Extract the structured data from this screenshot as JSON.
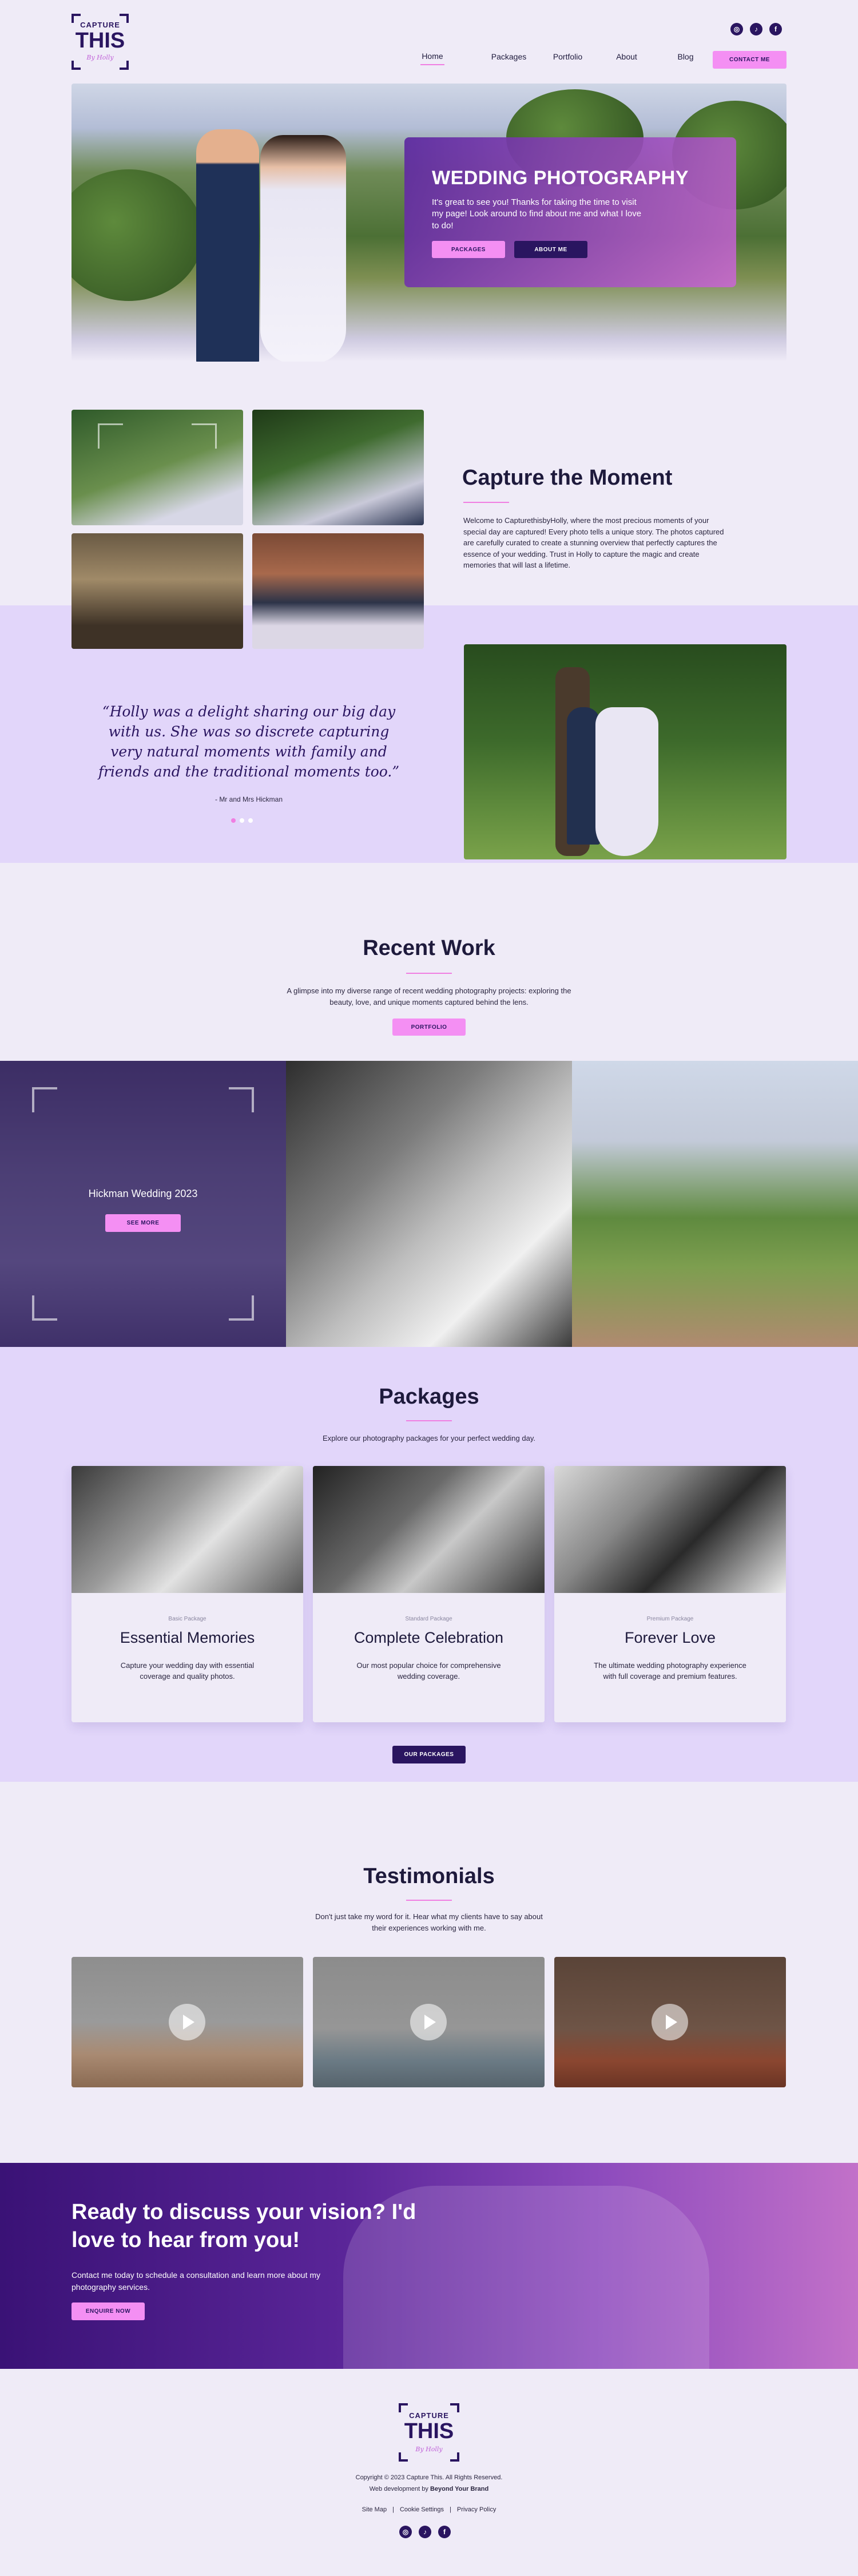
{
  "brand": {
    "logo_top": "CAPTURE",
    "logo_main": "THIS",
    "logo_sub": "By Holly"
  },
  "social": {
    "instagram": "◎",
    "tiktok": "♪",
    "facebook": "f"
  },
  "nav": {
    "items": [
      "Home",
      "Packages",
      "Portfolio",
      "About",
      "Blog"
    ],
    "contact": "CONTACT ME"
  },
  "hero": {
    "title": "WEDDING PHOTOGRAPHY",
    "text": "It's great to see you! Thanks for taking the time to visit my page! Look around to find about me and what I love to do!",
    "btn_packages": "PACKAGES",
    "btn_about": "ABOUT ME"
  },
  "capture": {
    "title": "Capture the Moment",
    "text": "Welcome to CapturethisbyHolly, where the most precious moments of your special day are captured! Every photo tells a unique story. The photos captured are carefully curated to create a stunning overview that perfectly captures the essence of your wedding. Trust in Holly to capture the magic and create memories that will last a lifetime."
  },
  "testimonial_quote": {
    "text": "“Holly was a delight sharing our big day with us. She was so discrete capturing very natural moments with family and friends and the traditional moments too.”",
    "author": "- Mr and Mrs Hickman"
  },
  "recent": {
    "title": "Recent Work",
    "text": "A glimpse into my diverse range of recent wedding photography projects: exploring the beauty, love, and unique moments captured behind the lens.",
    "button": "PORTFOLIO",
    "featured_title": "Hickman Wedding 2023",
    "featured_button": "SEE MORE"
  },
  "packages": {
    "title": "Packages",
    "text": "Explore our photography packages for your perfect wedding day.",
    "items": [
      {
        "tier": "Basic Package",
        "name": "Essential Memories",
        "desc": "Capture your wedding day with essential coverage and quality photos."
      },
      {
        "tier": "Standard Package",
        "name": "Complete Celebration",
        "desc": "Our most popular choice for comprehensive wedding coverage."
      },
      {
        "tier": "Premium Package",
        "name": "Forever Love",
        "desc": "The ultimate wedding photography experience with full coverage and premium features."
      }
    ],
    "button": "OUR PACKAGES"
  },
  "testimonials": {
    "title": "Testimonials",
    "text": "Don't just take my word for it. Hear what my clients have to say about their experiences working with me."
  },
  "cta": {
    "title": "Ready to discuss your vision? I'd love to hear from you!",
    "text": "Contact me today to schedule a consultation and learn more about my photography services.",
    "button": "ENQUIRE NOW"
  },
  "footer": {
    "copyright": "Copyright © 2023 Capture This. All Rights Reserved.",
    "webdev_prefix": "Web development by",
    "webdev_name": "Beyond Your Brand",
    "links": [
      "Site Map",
      "Cookie Settings",
      "Privacy Policy"
    ],
    "separator": "|"
  }
}
